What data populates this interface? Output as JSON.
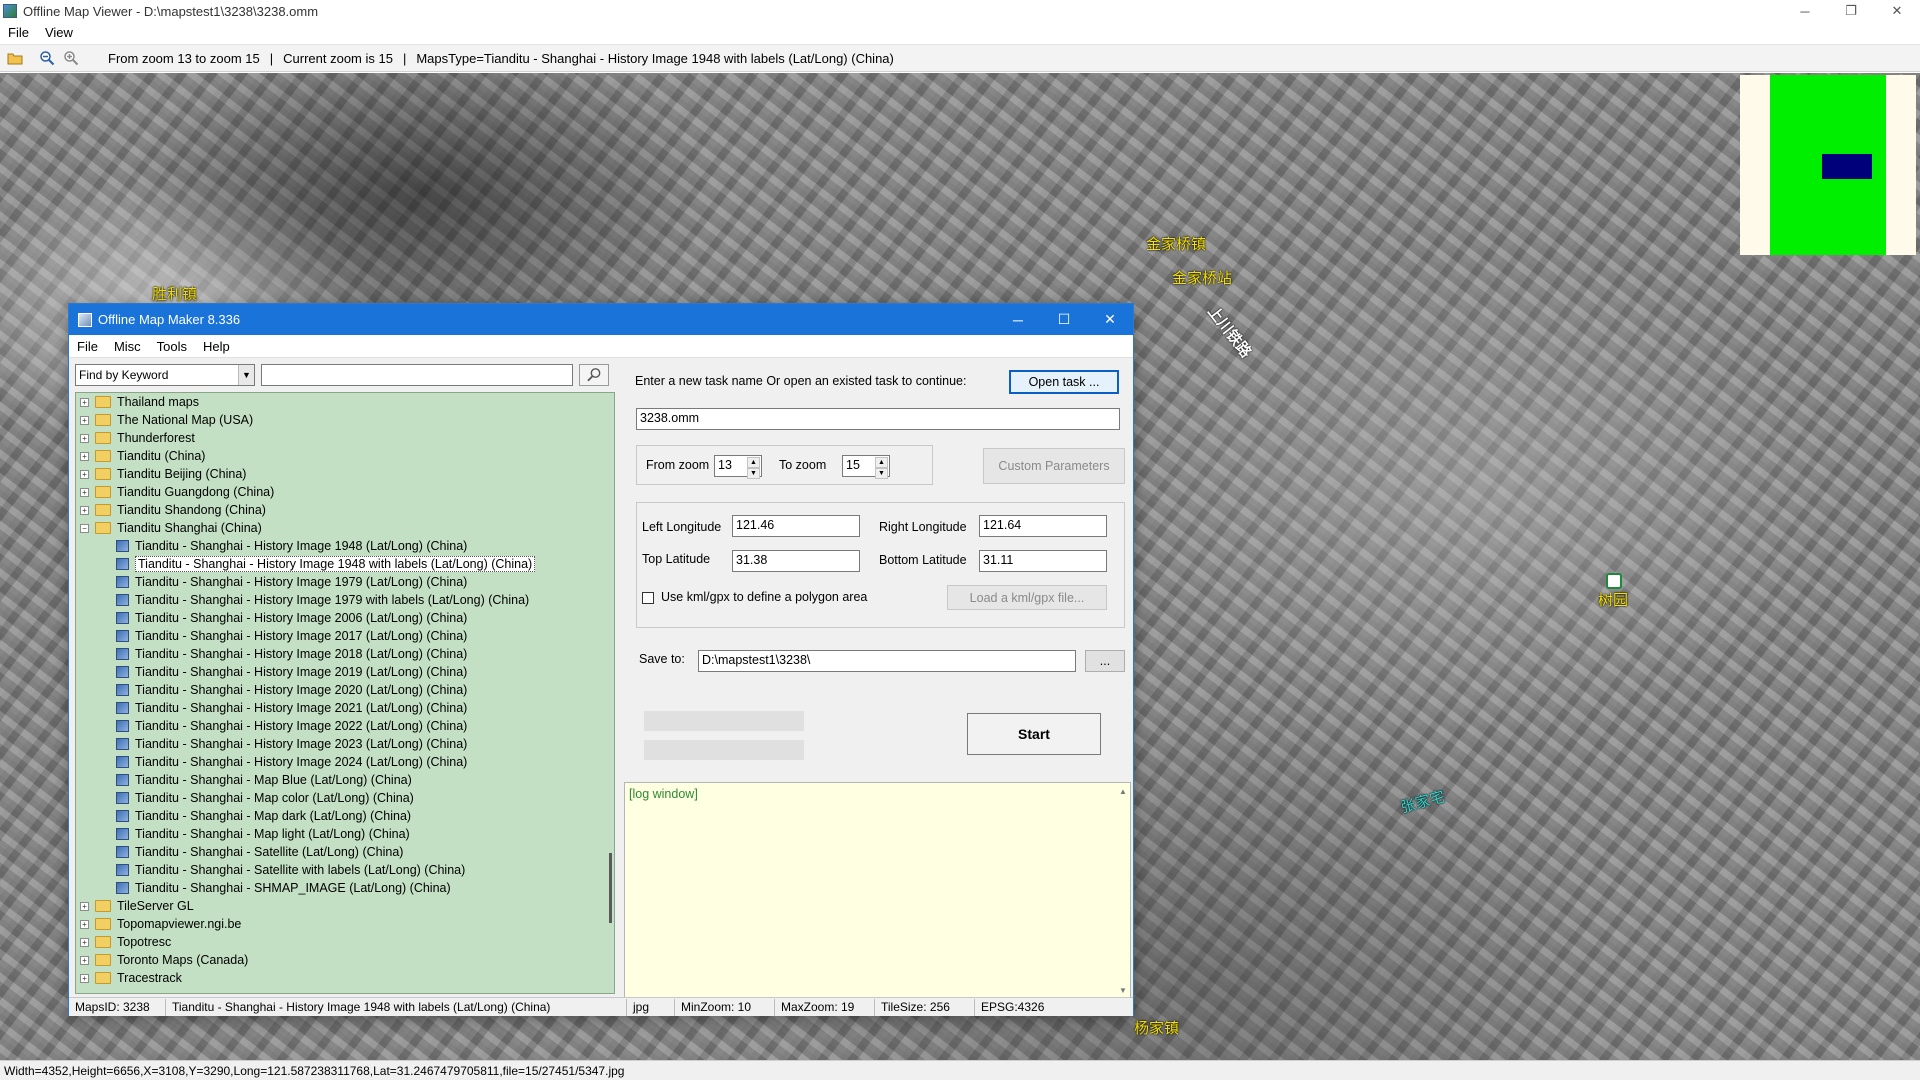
{
  "window": {
    "title": "Offline Map Viewer - D:\\mapstest1\\3238\\3238.omm",
    "controls": {
      "minimize": "─",
      "restore": "❐",
      "close": "✕"
    }
  },
  "menu": [
    "File",
    "View"
  ],
  "toolbar": {
    "icons": [
      "open-folder-icon",
      "zoom-out-icon",
      "zoom-in-icon"
    ],
    "zoom_range": "From zoom 13 to zoom 15",
    "current_zoom": "Current zoom is 15",
    "maps_type": "MapsType=Tianditu - Shanghai - History Image 1948 with labels (Lat/Long) (China)",
    "sep": "|"
  },
  "map": {
    "labels": [
      {
        "text": "金家桥镇",
        "style": "yellow"
      },
      {
        "text": "金家桥站",
        "style": "yellow"
      },
      {
        "text": "上川铁路",
        "style": "white"
      },
      {
        "text": "胜利镇",
        "style": "yellow"
      },
      {
        "text": "树园",
        "style": "yellow"
      },
      {
        "text": "张家宅",
        "style": "cyan"
      },
      {
        "text": "杨家镇",
        "style": "yellow"
      }
    ]
  },
  "status_bar": "Width=4352,Height=6656,X=3108,Y=3290,Long=121.587238311768,Lat=31.2467479705811,file=15/27451/5347.jpg",
  "dialog": {
    "title": "Offline Map Maker 8.336",
    "controls": {
      "minimize": "─",
      "maximize": "☐",
      "close": "✕"
    },
    "menu": [
      "File",
      "Misc",
      "Tools",
      "Help"
    ],
    "search": {
      "mode": "Find by Keyword",
      "value": ""
    },
    "tree": [
      {
        "label": "Thailand maps",
        "kind": "folder",
        "expander": "+"
      },
      {
        "label": "The National Map (USA)",
        "kind": "folder",
        "expander": "+"
      },
      {
        "label": "Thunderforest",
        "kind": "folder",
        "expander": "+"
      },
      {
        "label": "Tianditu (China)",
        "kind": "folder",
        "expander": "+"
      },
      {
        "label": "Tianditu Beijing (China)",
        "kind": "folder",
        "expander": "+"
      },
      {
        "label": "Tianditu Guangdong (China)",
        "kind": "folder",
        "expander": "+"
      },
      {
        "label": "Tianditu Shandong (China)",
        "kind": "folder",
        "expander": "+"
      },
      {
        "label": "Tianditu Shanghai (China)",
        "kind": "folder",
        "expander": "−"
      },
      {
        "label": "Tianditu - Shanghai - History Image 1948 (Lat/Long) (China)",
        "kind": "map"
      },
      {
        "label": "Tianditu - Shanghai - History Image 1948 with labels (Lat/Long) (China)",
        "kind": "map",
        "selected": true
      },
      {
        "label": "Tianditu - Shanghai - History Image 1979 (Lat/Long) (China)",
        "kind": "map"
      },
      {
        "label": "Tianditu - Shanghai - History Image 1979 with labels (Lat/Long) (China)",
        "kind": "map"
      },
      {
        "label": "Tianditu - Shanghai - History Image 2006 (Lat/Long) (China)",
        "kind": "map"
      },
      {
        "label": "Tianditu - Shanghai - History Image 2017 (Lat/Long) (China)",
        "kind": "map"
      },
      {
        "label": "Tianditu - Shanghai - History Image 2018 (Lat/Long) (China)",
        "kind": "map"
      },
      {
        "label": "Tianditu - Shanghai - History Image 2019 (Lat/Long) (China)",
        "kind": "map"
      },
      {
        "label": "Tianditu - Shanghai - History Image 2020 (Lat/Long) (China)",
        "kind": "map"
      },
      {
        "label": "Tianditu - Shanghai - History Image 2021 (Lat/Long) (China)",
        "kind": "map"
      },
      {
        "label": "Tianditu - Shanghai - History Image 2022 (Lat/Long) (China)",
        "kind": "map"
      },
      {
        "label": "Tianditu - Shanghai - History Image 2023 (Lat/Long) (China)",
        "kind": "map"
      },
      {
        "label": "Tianditu - Shanghai - History Image 2024 (Lat/Long) (China)",
        "kind": "map"
      },
      {
        "label": "Tianditu - Shanghai - Map Blue (Lat/Long) (China)",
        "kind": "map"
      },
      {
        "label": "Tianditu - Shanghai - Map color (Lat/Long) (China)",
        "kind": "map"
      },
      {
        "label": "Tianditu - Shanghai - Map dark (Lat/Long) (China)",
        "kind": "map"
      },
      {
        "label": "Tianditu - Shanghai - Map light (Lat/Long) (China)",
        "kind": "map"
      },
      {
        "label": "Tianditu - Shanghai - Satellite (Lat/Long) (China)",
        "kind": "map"
      },
      {
        "label": "Tianditu - Shanghai - Satellite with labels (Lat/Long) (China)",
        "kind": "map"
      },
      {
        "label": "Tianditu - Shanghai - SHMAP_IMAGE (Lat/Long) (China)",
        "kind": "map"
      },
      {
        "label": "TileServer GL",
        "kind": "folder",
        "expander": "+"
      },
      {
        "label": "Topomapviewer.ngi.be",
        "kind": "folder",
        "expander": "+"
      },
      {
        "label": "Topotresc",
        "kind": "folder",
        "expander": "+"
      },
      {
        "label": "Toronto Maps (Canada)",
        "kind": "folder",
        "expander": "+"
      },
      {
        "label": "Tracestrack",
        "kind": "folder",
        "expander": "+"
      }
    ],
    "task_prompt": "Enter a new task name Or open an existed task to continue:",
    "open_task_label": "Open task ...",
    "task_name": "3238.omm",
    "from_zoom_label": "From zoom",
    "from_zoom": "13",
    "to_zoom_label": "To zoom",
    "to_zoom": "15",
    "custom_params_label": "Custom Parameters",
    "left_lon_label": "Left Longitude",
    "left_lon": "121.46",
    "right_lon_label": "Right Longitude",
    "right_lon": "121.64",
    "top_lat_label": "Top Latitude",
    "top_lat": "31.38",
    "bottom_lat_label": "Bottom Latitude",
    "bottom_lat": "31.11",
    "kml_checkbox_label": "Use kml/gpx to define a polygon area",
    "load_kml_label": "Load a kml/gpx file...",
    "save_to_label": "Save to:",
    "save_to": "D:\\mapstest1\\3238\\",
    "browse_label": "...",
    "start_label": "Start",
    "log_text": "[log window]",
    "status": {
      "maps_id": "MapsID: 3238",
      "map_name": "Tianditu - Shanghai - History Image 1948 with labels (Lat/Long) (China)",
      "format": "jpg",
      "min_zoom": "MinZoom: 10",
      "max_zoom": "MaxZoom: 19",
      "tile_size": "TileSize: 256",
      "epsg": "EPSG:4326"
    }
  }
}
